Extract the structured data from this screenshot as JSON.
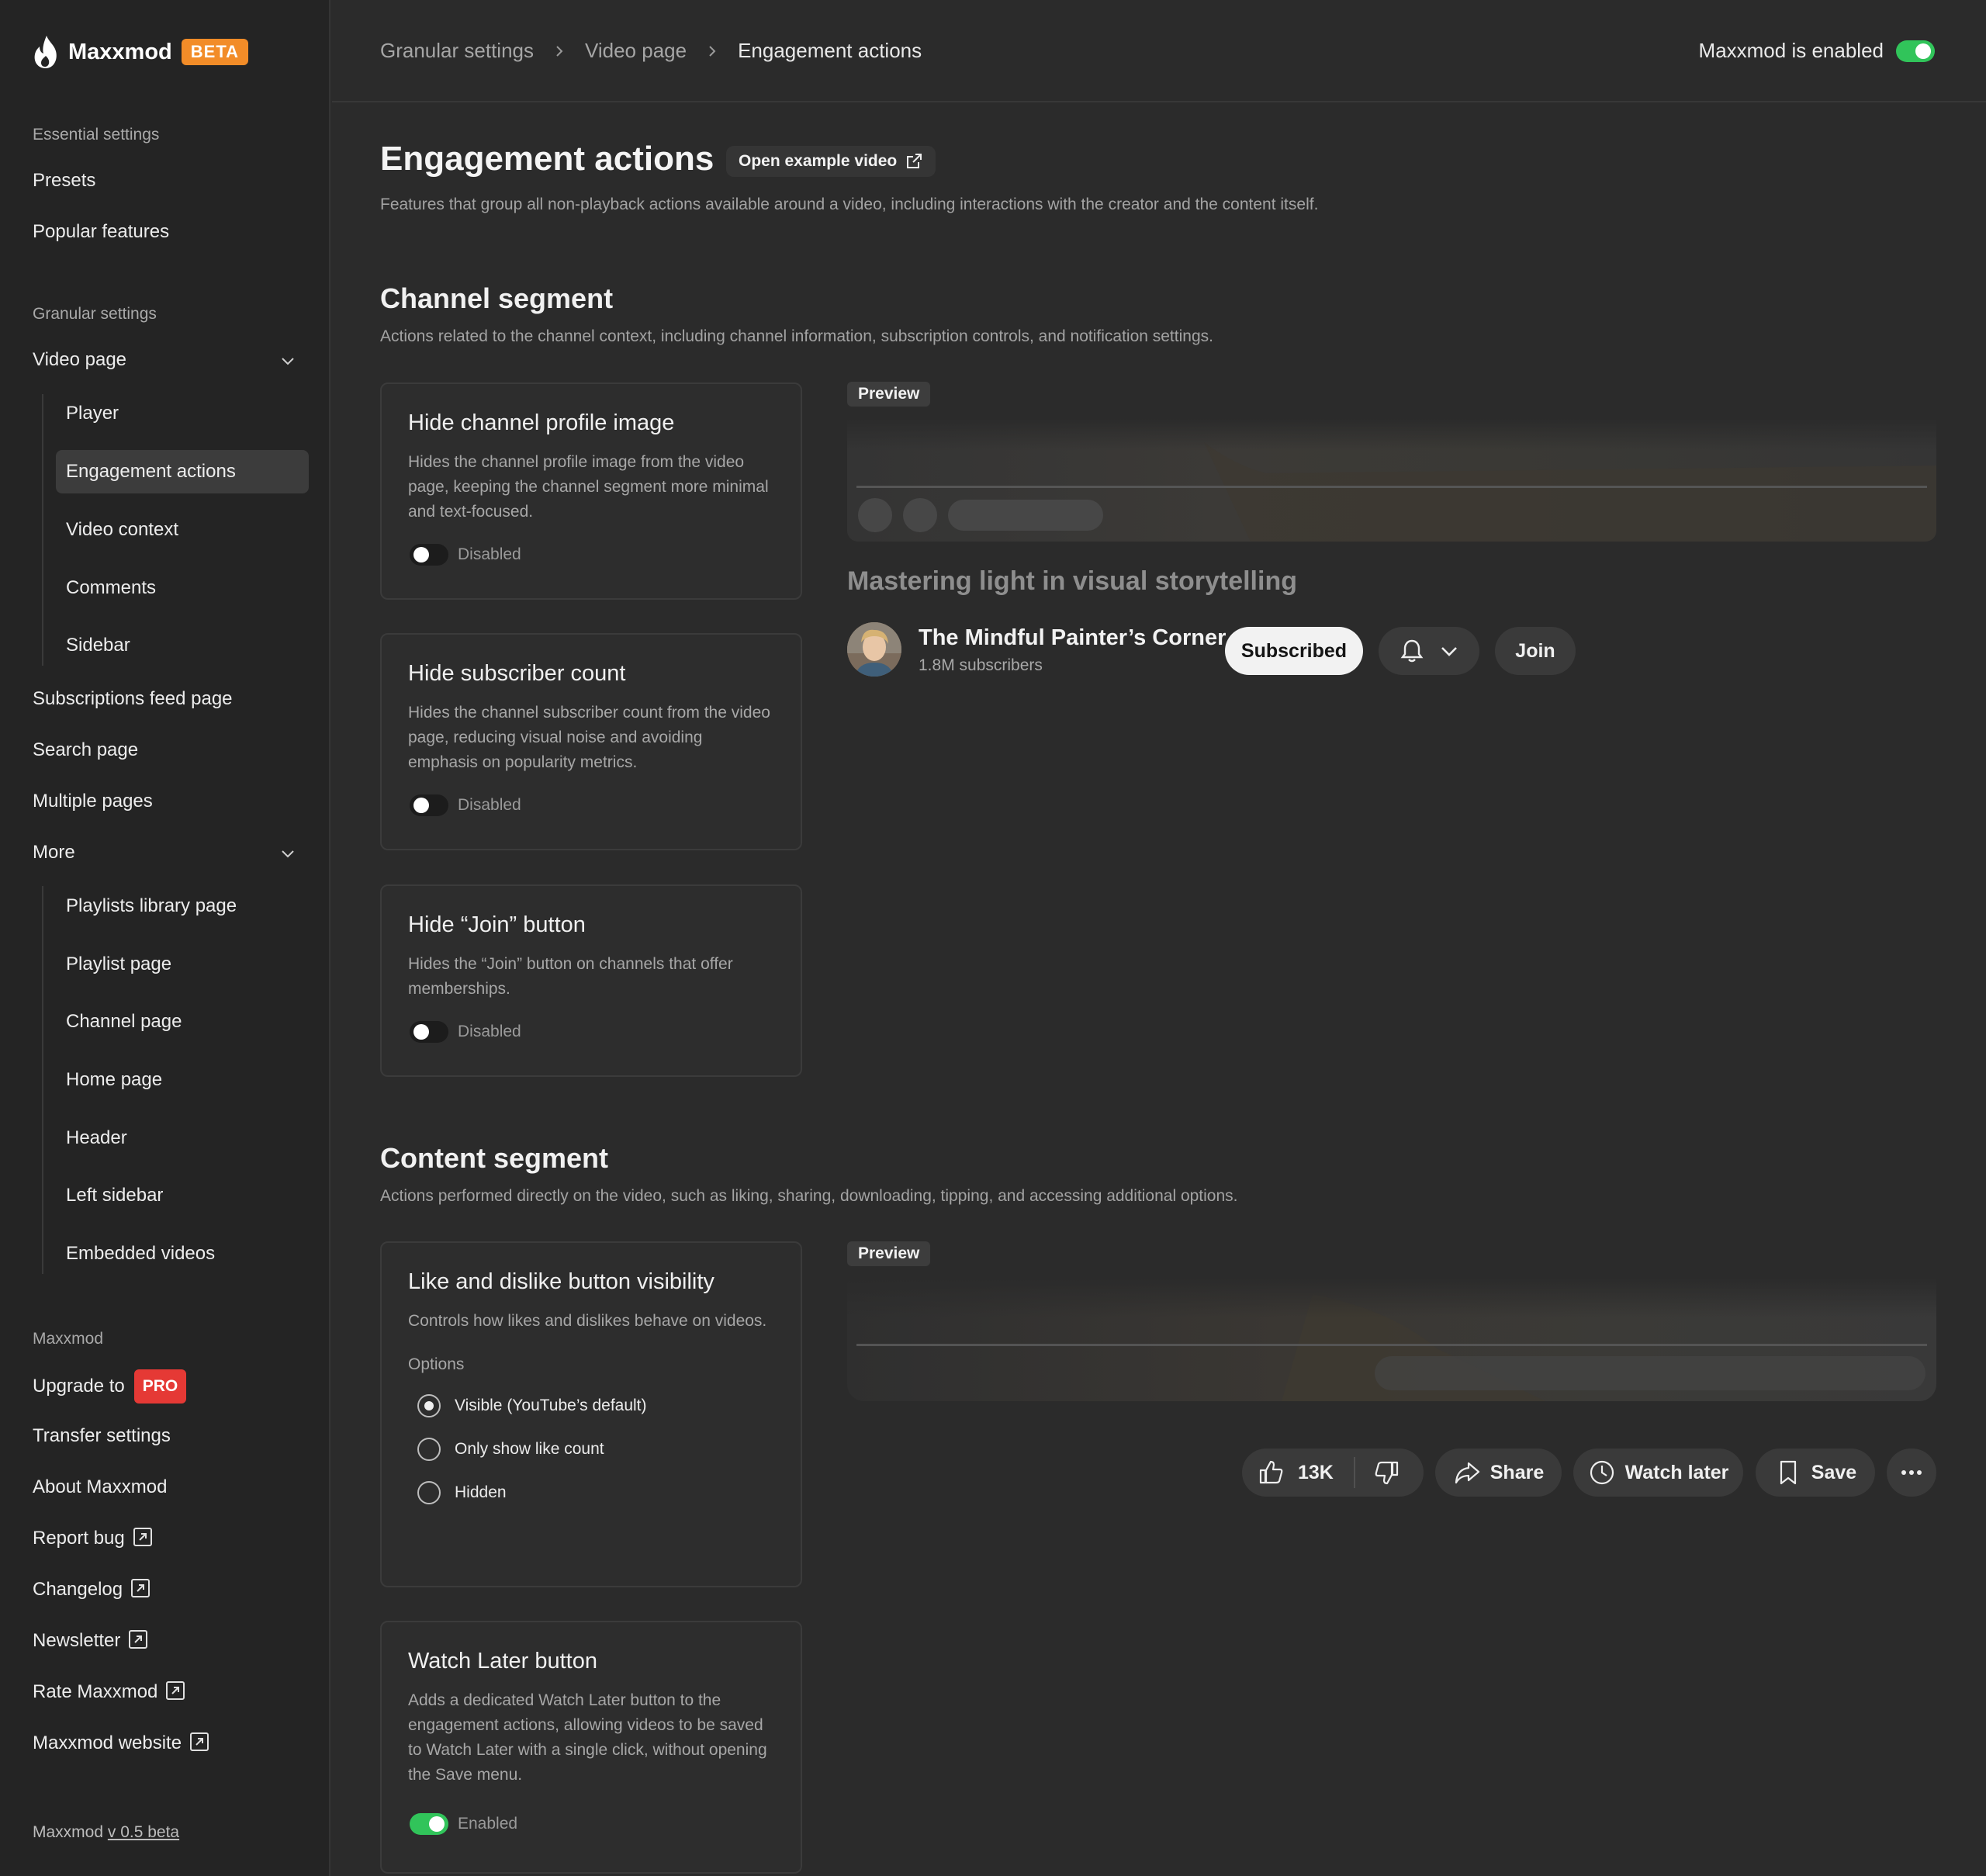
{
  "brand": {
    "name": "Maxxmod",
    "badge": "BETA"
  },
  "sidebar": {
    "essential_title": "Essential settings",
    "presets": "Presets",
    "popular": "Popular features",
    "granular_title": "Granular settings",
    "video_page": "Video page",
    "video_sub": [
      "Player",
      "Engagement actions",
      "Video context",
      "Comments",
      "Sidebar"
    ],
    "subscriptions": "Subscriptions feed page",
    "search": "Search page",
    "multiple": "Multiple pages",
    "more": "More",
    "more_sub": [
      "Playlists library page",
      "Playlist page",
      "Channel page",
      "Home page",
      "Header",
      "Left sidebar",
      "Embedded videos"
    ],
    "maxxmod_title": "Maxxmod",
    "upgrade": "Upgrade to",
    "pro": "PRO",
    "transfer": "Transfer settings",
    "about": "About Maxxmod",
    "report": "Report bug",
    "changelog": "Changelog",
    "newsletter": "Newsletter",
    "rate": "Rate Maxxmod",
    "website": "Maxxmod website",
    "version_prefix": "Maxxmod",
    "version": "v 0.5 beta"
  },
  "header": {
    "crumbs": [
      "Granular settings",
      "Video page",
      "Engagement actions"
    ],
    "enabled_label": "Maxxmod is enabled"
  },
  "page": {
    "title": "Engagement actions",
    "open_video": "Open example video",
    "description": "Features that group all non-playback actions available around a video, including interactions with the creator and the content itself."
  },
  "channel_segment": {
    "title": "Channel segment",
    "description": "Actions related to the channel context, including channel information, subscription controls, and notification settings.",
    "cards": [
      {
        "title": "Hide channel profile image",
        "desc": "Hides the channel profile image from the video page, keeping the channel segment more minimal and text-focused.",
        "state": "Disabled"
      },
      {
        "title": "Hide subscriber count",
        "desc": "Hides the channel subscriber count from the video page, reducing visual noise and avoiding emphasis on popularity metrics.",
        "state": "Disabled"
      },
      {
        "title": "Hide “Join” button",
        "desc": "Hides the “Join” button on channels that offer memberships.",
        "state": "Disabled"
      }
    ],
    "preview": {
      "tag": "Preview",
      "video_title": "Mastering light in visual storytelling",
      "channel_name": "The Mindful Painter’s Corner",
      "subscribers": "1.8M subscribers",
      "subscribed": "Subscribed",
      "join": "Join"
    }
  },
  "content_segment": {
    "title": "Content segment",
    "description": "Actions performed directly on the video, such as liking, sharing, downloading, tipping, and accessing additional options.",
    "like_card": {
      "title": "Like and dislike button visibility",
      "desc": "Controls how likes and dislikes behave on videos.",
      "options_label": "Options",
      "options": [
        "Visible (YouTube’s default)",
        "Only show like count",
        "Hidden"
      ]
    },
    "watch_later_card": {
      "title": "Watch Later button",
      "desc": "Adds a dedicated Watch Later button to the engagement actions, allowing videos to be saved to Watch Later with a single click, without opening the Save menu.",
      "state": "Enabled"
    },
    "preview": {
      "tag": "Preview",
      "likes": "13K",
      "share": "Share",
      "watch_later": "Watch later",
      "save": "Save"
    }
  }
}
